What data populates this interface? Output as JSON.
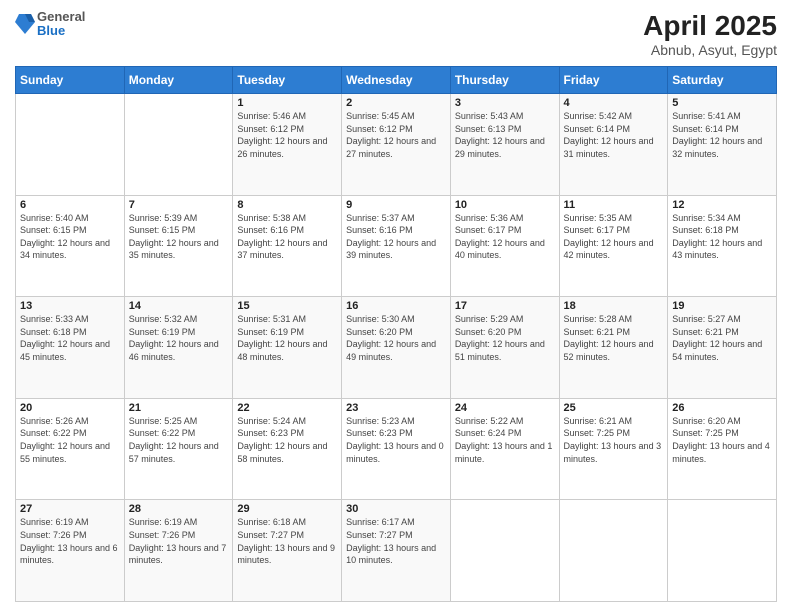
{
  "logo": {
    "general": "General",
    "blue": "Blue"
  },
  "title": "April 2025",
  "subtitle": "Abnub, Asyut, Egypt",
  "days_of_week": [
    "Sunday",
    "Monday",
    "Tuesday",
    "Wednesday",
    "Thursday",
    "Friday",
    "Saturday"
  ],
  "weeks": [
    [
      {
        "day": "",
        "sunrise": "",
        "sunset": "",
        "daylight": ""
      },
      {
        "day": "",
        "sunrise": "",
        "sunset": "",
        "daylight": ""
      },
      {
        "day": "1",
        "sunrise": "Sunrise: 5:46 AM",
        "sunset": "Sunset: 6:12 PM",
        "daylight": "Daylight: 12 hours and 26 minutes."
      },
      {
        "day": "2",
        "sunrise": "Sunrise: 5:45 AM",
        "sunset": "Sunset: 6:12 PM",
        "daylight": "Daylight: 12 hours and 27 minutes."
      },
      {
        "day": "3",
        "sunrise": "Sunrise: 5:43 AM",
        "sunset": "Sunset: 6:13 PM",
        "daylight": "Daylight: 12 hours and 29 minutes."
      },
      {
        "day": "4",
        "sunrise": "Sunrise: 5:42 AM",
        "sunset": "Sunset: 6:14 PM",
        "daylight": "Daylight: 12 hours and 31 minutes."
      },
      {
        "day": "5",
        "sunrise": "Sunrise: 5:41 AM",
        "sunset": "Sunset: 6:14 PM",
        "daylight": "Daylight: 12 hours and 32 minutes."
      }
    ],
    [
      {
        "day": "6",
        "sunrise": "Sunrise: 5:40 AM",
        "sunset": "Sunset: 6:15 PM",
        "daylight": "Daylight: 12 hours and 34 minutes."
      },
      {
        "day": "7",
        "sunrise": "Sunrise: 5:39 AM",
        "sunset": "Sunset: 6:15 PM",
        "daylight": "Daylight: 12 hours and 35 minutes."
      },
      {
        "day": "8",
        "sunrise": "Sunrise: 5:38 AM",
        "sunset": "Sunset: 6:16 PM",
        "daylight": "Daylight: 12 hours and 37 minutes."
      },
      {
        "day": "9",
        "sunrise": "Sunrise: 5:37 AM",
        "sunset": "Sunset: 6:16 PM",
        "daylight": "Daylight: 12 hours and 39 minutes."
      },
      {
        "day": "10",
        "sunrise": "Sunrise: 5:36 AM",
        "sunset": "Sunset: 6:17 PM",
        "daylight": "Daylight: 12 hours and 40 minutes."
      },
      {
        "day": "11",
        "sunrise": "Sunrise: 5:35 AM",
        "sunset": "Sunset: 6:17 PM",
        "daylight": "Daylight: 12 hours and 42 minutes."
      },
      {
        "day": "12",
        "sunrise": "Sunrise: 5:34 AM",
        "sunset": "Sunset: 6:18 PM",
        "daylight": "Daylight: 12 hours and 43 minutes."
      }
    ],
    [
      {
        "day": "13",
        "sunrise": "Sunrise: 5:33 AM",
        "sunset": "Sunset: 6:18 PM",
        "daylight": "Daylight: 12 hours and 45 minutes."
      },
      {
        "day": "14",
        "sunrise": "Sunrise: 5:32 AM",
        "sunset": "Sunset: 6:19 PM",
        "daylight": "Daylight: 12 hours and 46 minutes."
      },
      {
        "day": "15",
        "sunrise": "Sunrise: 5:31 AM",
        "sunset": "Sunset: 6:19 PM",
        "daylight": "Daylight: 12 hours and 48 minutes."
      },
      {
        "day": "16",
        "sunrise": "Sunrise: 5:30 AM",
        "sunset": "Sunset: 6:20 PM",
        "daylight": "Daylight: 12 hours and 49 minutes."
      },
      {
        "day": "17",
        "sunrise": "Sunrise: 5:29 AM",
        "sunset": "Sunset: 6:20 PM",
        "daylight": "Daylight: 12 hours and 51 minutes."
      },
      {
        "day": "18",
        "sunrise": "Sunrise: 5:28 AM",
        "sunset": "Sunset: 6:21 PM",
        "daylight": "Daylight: 12 hours and 52 minutes."
      },
      {
        "day": "19",
        "sunrise": "Sunrise: 5:27 AM",
        "sunset": "Sunset: 6:21 PM",
        "daylight": "Daylight: 12 hours and 54 minutes."
      }
    ],
    [
      {
        "day": "20",
        "sunrise": "Sunrise: 5:26 AM",
        "sunset": "Sunset: 6:22 PM",
        "daylight": "Daylight: 12 hours and 55 minutes."
      },
      {
        "day": "21",
        "sunrise": "Sunrise: 5:25 AM",
        "sunset": "Sunset: 6:22 PM",
        "daylight": "Daylight: 12 hours and 57 minutes."
      },
      {
        "day": "22",
        "sunrise": "Sunrise: 5:24 AM",
        "sunset": "Sunset: 6:23 PM",
        "daylight": "Daylight: 12 hours and 58 minutes."
      },
      {
        "day": "23",
        "sunrise": "Sunrise: 5:23 AM",
        "sunset": "Sunset: 6:23 PM",
        "daylight": "Daylight: 13 hours and 0 minutes."
      },
      {
        "day": "24",
        "sunrise": "Sunrise: 5:22 AM",
        "sunset": "Sunset: 6:24 PM",
        "daylight": "Daylight: 13 hours and 1 minute."
      },
      {
        "day": "25",
        "sunrise": "Sunrise: 6:21 AM",
        "sunset": "Sunset: 7:25 PM",
        "daylight": "Daylight: 13 hours and 3 minutes."
      },
      {
        "day": "26",
        "sunrise": "Sunrise: 6:20 AM",
        "sunset": "Sunset: 7:25 PM",
        "daylight": "Daylight: 13 hours and 4 minutes."
      }
    ],
    [
      {
        "day": "27",
        "sunrise": "Sunrise: 6:19 AM",
        "sunset": "Sunset: 7:26 PM",
        "daylight": "Daylight: 13 hours and 6 minutes."
      },
      {
        "day": "28",
        "sunrise": "Sunrise: 6:19 AM",
        "sunset": "Sunset: 7:26 PM",
        "daylight": "Daylight: 13 hours and 7 minutes."
      },
      {
        "day": "29",
        "sunrise": "Sunrise: 6:18 AM",
        "sunset": "Sunset: 7:27 PM",
        "daylight": "Daylight: 13 hours and 9 minutes."
      },
      {
        "day": "30",
        "sunrise": "Sunrise: 6:17 AM",
        "sunset": "Sunset: 7:27 PM",
        "daylight": "Daylight: 13 hours and 10 minutes."
      },
      {
        "day": "",
        "sunrise": "",
        "sunset": "",
        "daylight": ""
      },
      {
        "day": "",
        "sunrise": "",
        "sunset": "",
        "daylight": ""
      },
      {
        "day": "",
        "sunrise": "",
        "sunset": "",
        "daylight": ""
      }
    ]
  ]
}
